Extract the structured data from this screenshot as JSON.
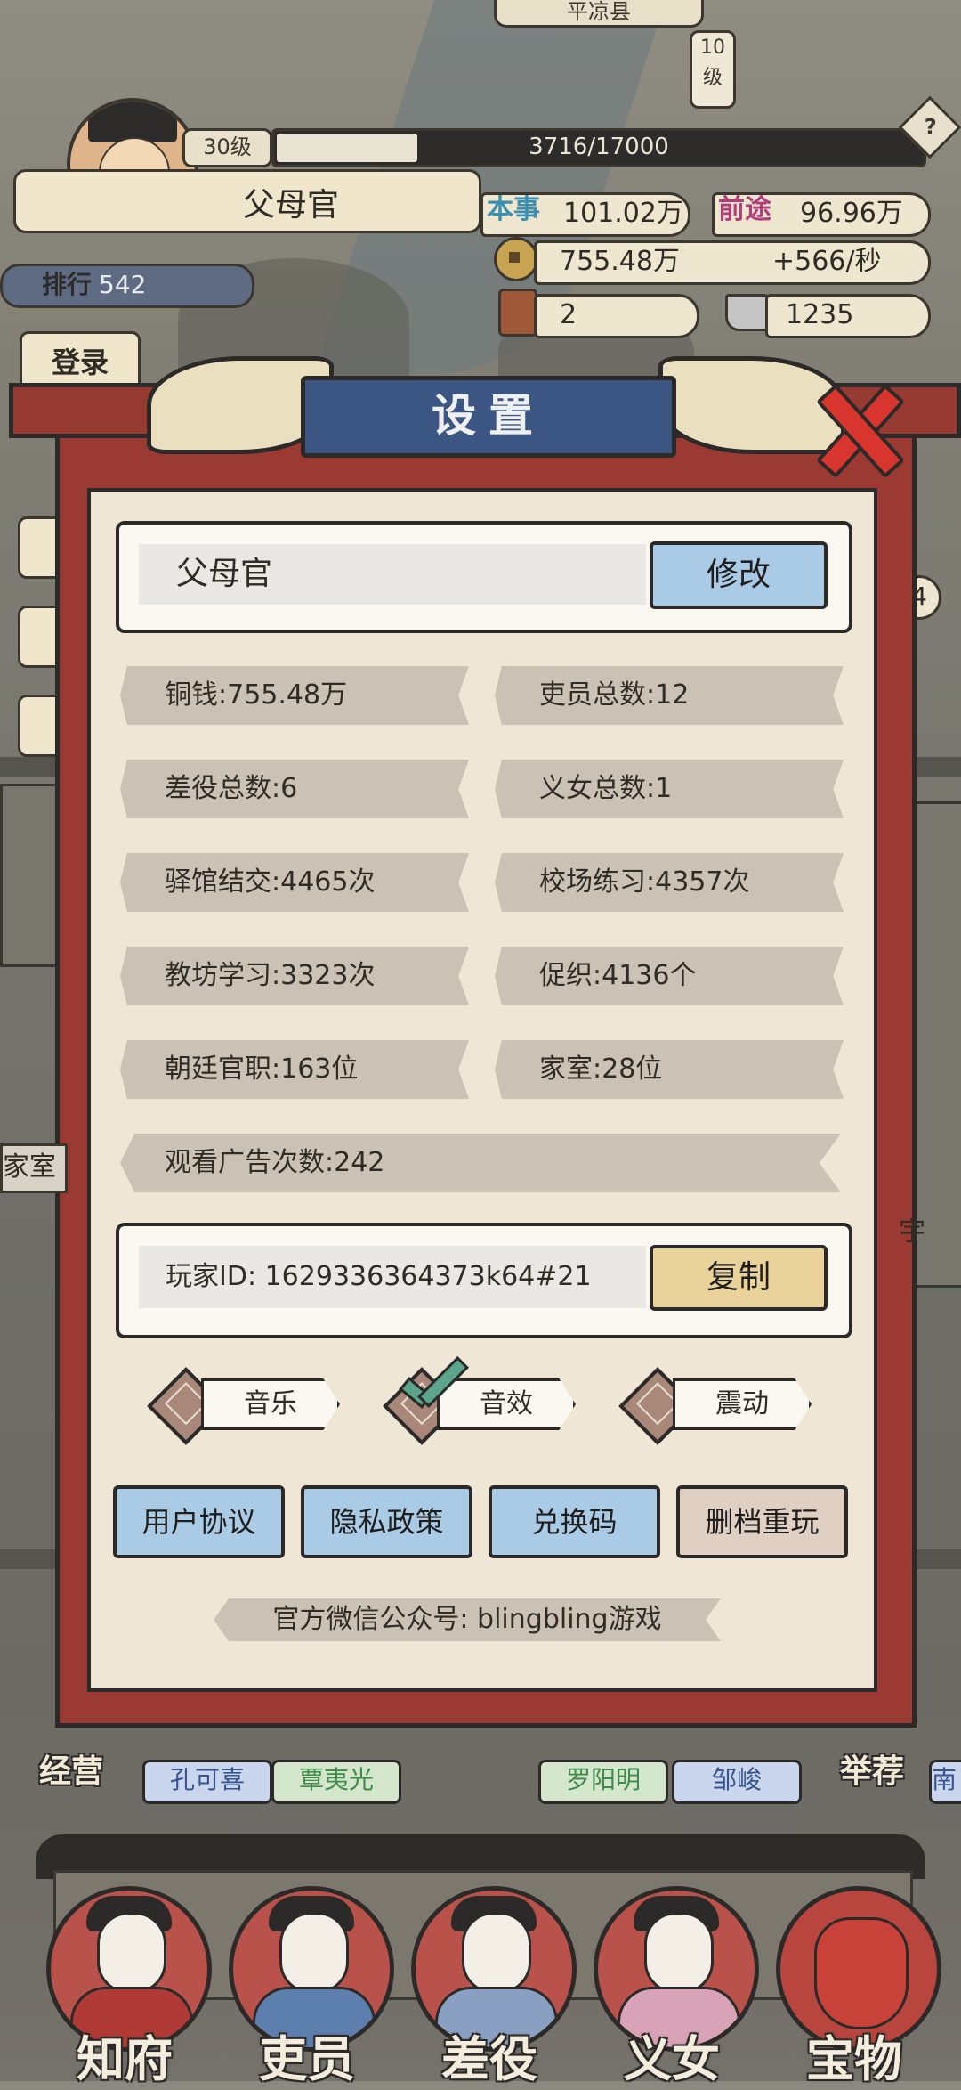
{
  "hud": {
    "county": "平凉县",
    "county_level": "10\n级",
    "player_level": "30级",
    "exp_text": "3716/17000",
    "exp_progress": 0.218,
    "title_name": "父母官",
    "help": "?",
    "stat_skill_label": "本事",
    "stat_skill_value": "101.02万",
    "stat_future_label": "前途",
    "stat_future_value": "96.96万",
    "coins": "755.48万",
    "coins_rate": "+566/秒",
    "tokens": "2",
    "silver": "1235",
    "rank_label": "排行",
    "rank_value": "542",
    "login": "登录",
    "badge_4": "4"
  },
  "settings": {
    "title": "设置",
    "player_name": "父母官",
    "modify_button": "修改",
    "stats": [
      "铜钱:755.48万",
      "吏员总数:12",
      "差役总数:6",
      "义女总数:1",
      "驿馆结交:4465次",
      "校场练习:4357次",
      "教坊学习:3323次",
      "促织:4136个",
      "朝廷官职:163位",
      "家室:28位"
    ],
    "ad_count": "观看广告次数:242",
    "player_id": "玩家ID: 1629336364373k64#21",
    "copy_button": "复制",
    "toggles": [
      {
        "label": "音乐",
        "checked": false
      },
      {
        "label": "音效",
        "checked": true
      },
      {
        "label": "震动",
        "checked": false
      }
    ],
    "buttons": [
      "用户协议",
      "隐私政策",
      "兑换码",
      "删档重玩"
    ],
    "wechat": "官方微信公众号: blingbling游戏"
  },
  "bottom": {
    "left_tag": "经营",
    "right_tag": "举荐",
    "chips": [
      {
        "name": "孔可喜",
        "color": "blue"
      },
      {
        "name": "覃夷光",
        "color": "green"
      },
      {
        "name": "罗阳明",
        "color": "green"
      },
      {
        "name": "邹峻",
        "color": "blue"
      }
    ],
    "edge_left": "家室",
    "edge_right": "宇",
    "edge_right2": "南",
    "nav": [
      "知府",
      "吏员",
      "差役",
      "义女",
      "宝物"
    ]
  }
}
